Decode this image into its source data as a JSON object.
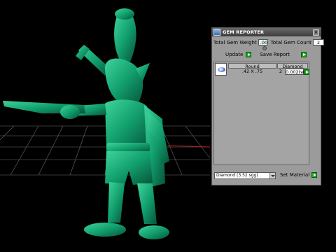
{
  "panel": {
    "title": "GEM REPORTER",
    "total_weight_label": "Total Gem Weight",
    "total_weight_value": ".00",
    "total_count_label": "Total Gem Count",
    "total_count_value": "2",
    "update_label": "Update",
    "save_report_label": "Save Report",
    "gems": {
      "columns": [
        "Round",
        "Diamond"
      ],
      "rows": [
        {
          "size": ".42 X .75",
          "count": "2",
          "weight": "0.002tw"
        }
      ]
    },
    "material_select": "Diamond   (3.52 sgg)",
    "set_material_label": "Set Material"
  },
  "colors": {
    "figure": "#12a06e",
    "panel_bg": "#9b9b9b",
    "go_button": "#1fa81f",
    "axis_red": "#cc1b1b",
    "grid": "#8f8f8f"
  }
}
